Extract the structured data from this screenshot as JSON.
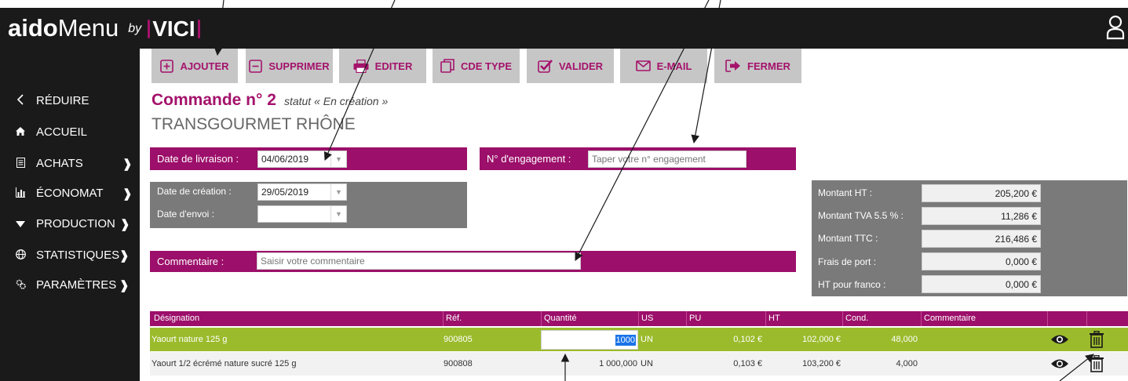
{
  "header": {
    "brand_bold": "aido",
    "brand_light": "Menu",
    "brand_by": "by",
    "brand_partner": "VICI"
  },
  "sidebar": {
    "items": [
      {
        "label": "RÉDUIRE",
        "icon": "chevron-left-icon"
      },
      {
        "label": "ACCUEIL",
        "icon": "home-icon"
      },
      {
        "label": "ACHATS",
        "icon": "document-icon",
        "chevron": "❱"
      },
      {
        "label": "ÉCONOMAT",
        "icon": "bar-chart-icon",
        "chevron": "❱"
      },
      {
        "label": "PRODUCTION",
        "icon": "caret-down-icon",
        "chevron": "❱"
      },
      {
        "label": "STATISTIQUES",
        "icon": "globe-icon",
        "chevron": "❱"
      },
      {
        "label": "PARAMÈTRES",
        "icon": "gears-icon",
        "chevron": "❱"
      }
    ]
  },
  "toolbar": {
    "add": "AJOUTER",
    "delete": "SUPPRIMER",
    "print": "EDITER",
    "order_type": "CDE TYPE",
    "validate": "VALIDER",
    "email": "E-MAIL",
    "close": "FERMER"
  },
  "order": {
    "title": "Commande n° 2",
    "status": "statut « En création »",
    "supplier": "TRANSGOURMET RHÔNE"
  },
  "form": {
    "delivery_label": "Date de livraison :",
    "delivery_value": "04/06/2019",
    "engagement_label": "N° d'engagement :",
    "engagement_placeholder": "Taper votre n° engagement",
    "creation_label": "Date de création :",
    "creation_value": "29/05/2019",
    "send_label": "Date d'envoi :",
    "send_value": "",
    "comment_label": "Commentaire :",
    "comment_placeholder": "Saisir votre commentaire"
  },
  "totals": [
    {
      "label": "Montant HT :",
      "value": "205,200 €"
    },
    {
      "label": "Montant TVA 5.5 % :",
      "value": "11,286 €"
    },
    {
      "label": "Montant TTC :",
      "value": "216,486 €"
    },
    {
      "label": "Frais de port :",
      "value": "0,000 €"
    },
    {
      "label": "HT pour franco :",
      "value": "0,000 €"
    }
  ],
  "table": {
    "columns": [
      "Désignation",
      "Réf.",
      "Quantité",
      "US",
      "PU",
      "HT",
      "Cond.",
      "Commentaire"
    ],
    "rows": [
      {
        "designation": "Yaourt nature 125 g",
        "ref": "900805",
        "quantite": "1000",
        "us": "UN",
        "pu": "0,102 €",
        "ht": "102,000 €",
        "cond": "48,000",
        "commentaire": ""
      },
      {
        "designation": "Yaourt 1/2 écrémé nature sucré 125 g",
        "ref": "900808",
        "quantite": "1 000,000",
        "us": "UN",
        "pu": "0,103 €",
        "ht": "103,200 €",
        "cond": "4,000",
        "commentaire": ""
      }
    ]
  },
  "colors": {
    "accent": "#9c0f6a",
    "row_selected": "#9bbb2c",
    "toolbar_bg": "#c6c6c6",
    "sidebar_bg": "#1a1a1a",
    "panel_gray": "#7a7a7a"
  }
}
